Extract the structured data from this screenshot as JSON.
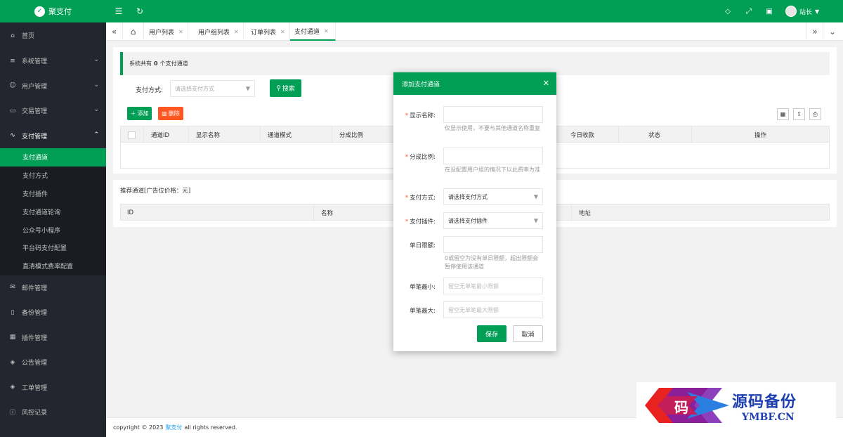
{
  "app": {
    "title": "聚支付"
  },
  "header": {
    "user": "站长"
  },
  "sidebar": {
    "items": [
      {
        "icon": "home-icon",
        "label": "首页"
      },
      {
        "icon": "sliders-icon",
        "label": "系统管理"
      },
      {
        "icon": "user-icon",
        "label": "用户管理"
      },
      {
        "icon": "file-icon",
        "label": "交易管理"
      },
      {
        "icon": "pulse-icon",
        "label": "支付管理"
      }
    ],
    "sub_items": [
      "支付通道",
      "支付方式",
      "支付插件",
      "支付通道轮询",
      "公众号小程序",
      "平台码支付配置",
      "直清模式费率配置"
    ],
    "bottom_items": [
      {
        "icon": "mail-icon",
        "label": "邮件管理"
      },
      {
        "icon": "backup-icon",
        "label": "备份管理"
      },
      {
        "icon": "plugin-icon",
        "label": "插件管理"
      },
      {
        "icon": "notice-icon",
        "label": "公告管理"
      },
      {
        "icon": "ticket-icon",
        "label": "工单管理"
      },
      {
        "icon": "risk-icon",
        "label": "风控记录"
      }
    ]
  },
  "tabs": [
    "用户列表",
    "用户组列表",
    "订单列表",
    "支付通道"
  ],
  "main": {
    "notice_prefix": "系统共有",
    "notice_count": "0",
    "notice_suffix": "个支付通道",
    "filter_label": "支付方式:",
    "filter_placeholder": "请选择支付方式",
    "search_label": "搜索",
    "add_label": "添加",
    "delete_label": "删除",
    "columns": [
      "通道ID",
      "显示名称",
      "通道模式",
      "分成比例",
      "今日收款",
      "状态",
      "操作"
    ],
    "recommend_title": "推荐通道[广告位价格：元]",
    "recommend_columns": [
      "ID",
      "名称",
      "地址"
    ]
  },
  "modal": {
    "title": "添加支付通道",
    "fields": {
      "display_name": {
        "label": "显示名称:",
        "tip": "仅显示使用，不要与其他通道名称重复"
      },
      "ratio": {
        "label": "分成比例:",
        "tip": "在没配置用户组的情况下以此费率为准"
      },
      "pay_type": {
        "label": "支付方式:",
        "value": "请选择支付方式"
      },
      "plugin": {
        "label": "支付插件:",
        "value": "请选择支付插件"
      },
      "day_limit": {
        "label": "单日限额:",
        "tip": "0或留空为没有单日限额，超出限额会暂停使用该通道"
      },
      "min": {
        "label": "单笔最小:",
        "placeholder": "留空无单笔最小限额"
      },
      "max": {
        "label": "单笔最大:",
        "placeholder": "留空无单笔最大限额"
      }
    },
    "save": "保存",
    "cancel": "取消"
  },
  "footer": {
    "prefix": "copyright © 2023",
    "link": "聚支付",
    "suffix": "all rights reserved."
  },
  "watermark": {
    "char": "码",
    "title": "源码备份",
    "url": "YMBF.CN"
  },
  "colors": {
    "primary": "#009f55",
    "danger": "#ff5722",
    "sidebar": "#23262e"
  }
}
